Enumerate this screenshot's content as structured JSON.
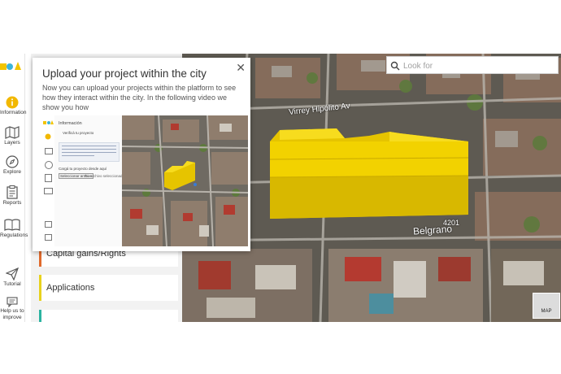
{
  "sidebar": {
    "items": [
      {
        "label": "Information",
        "icon": "info-icon"
      },
      {
        "label": "Layers",
        "icon": "map-icon"
      },
      {
        "label": "Explore",
        "icon": "compass-icon"
      },
      {
        "label": "Reports",
        "icon": "clipboard-icon"
      },
      {
        "label": "Regulations",
        "icon": "book-icon"
      },
      {
        "label": "Tutorial",
        "icon": "send-icon"
      },
      {
        "label": "Help us to improve",
        "icon": "chat-icon"
      }
    ]
  },
  "panel": {
    "sections": [
      {
        "label": "Capital gains/Rights",
        "color": "#e06a2c"
      },
      {
        "label": "Applications",
        "color": "#e8d21d"
      }
    ]
  },
  "modal": {
    "title": "Upload your project within the city",
    "body": "Now you can upload your projects within the platform to see how they interact within the city. In the following video we show you how",
    "video": {
      "panel_title": "Información",
      "back_label": "Verificá tu proyecto",
      "upload_label": "Cargá tu proyecto desde aquí",
      "select_button": "Seleccionar archivo",
      "no_file": "No archivo seleccionado"
    }
  },
  "search": {
    "placeholder": "Look for"
  },
  "map": {
    "street_top": "Virrey Hipólito Av",
    "street_bottom": "Belgrano",
    "house_number": "4201",
    "badge": "MAP",
    "building_color": "#f2d000"
  }
}
